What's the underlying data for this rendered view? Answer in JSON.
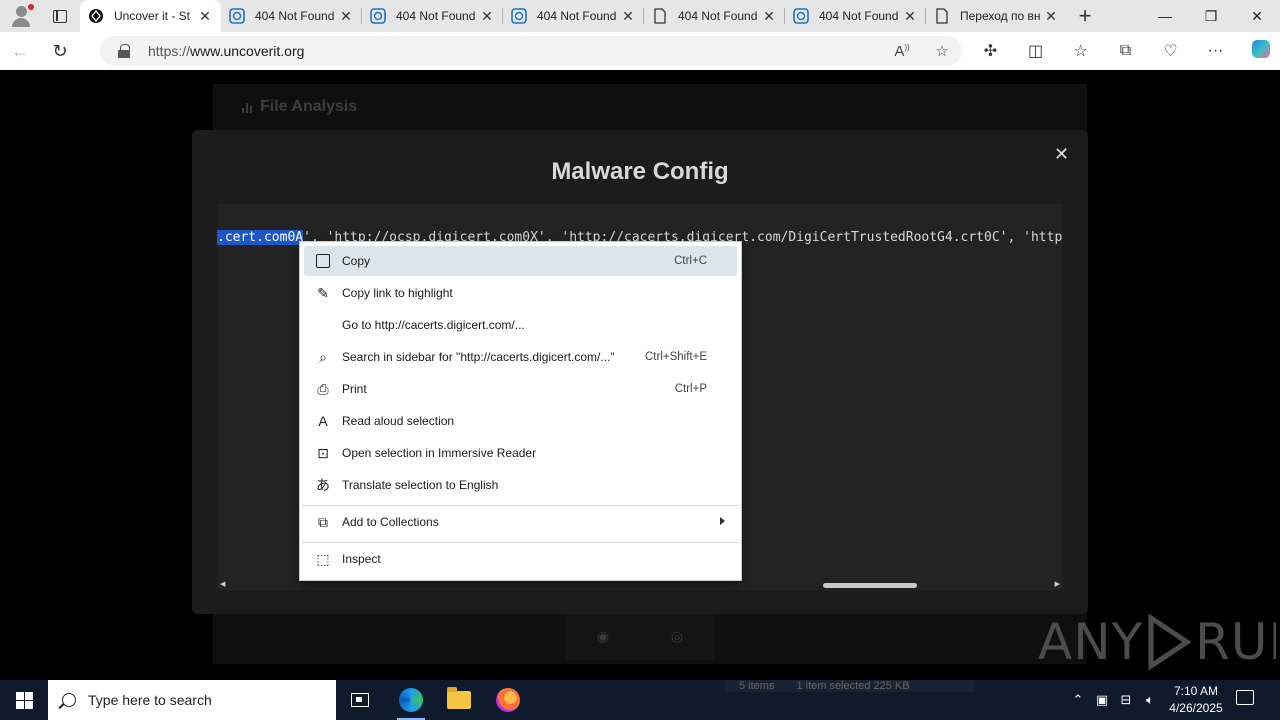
{
  "browser": {
    "tabs": [
      {
        "title": "Uncover it - St",
        "active": true,
        "favicon": "uncoverit-logo-icon"
      },
      {
        "title": "404 Not Found",
        "active": false,
        "favicon": "edge-page-icon"
      },
      {
        "title": "404 Not Found",
        "active": false,
        "favicon": "edge-page-icon"
      },
      {
        "title": "404 Not Found",
        "active": false,
        "favicon": "edge-page-icon"
      },
      {
        "title": "404 Not Found",
        "active": false,
        "favicon": "document-icon"
      },
      {
        "title": "404 Not Found",
        "active": false,
        "favicon": "edge-page-icon"
      },
      {
        "title": "Переход по вн",
        "active": false,
        "favicon": "document-icon"
      }
    ],
    "url_prefix": "https://",
    "url_host": "www.uncoverit.org"
  },
  "page": {
    "bg_title": "File Analysis",
    "modal": {
      "title": "Malware Config",
      "selected_text": ".cert.com0A",
      "code_rest": "', 'http://ocsp.digicert.com0X', 'http://cacerts.digicert.com/DigiCertTrustedRootG4.crt0C', 'http"
    },
    "watermark": "ANY RUN"
  },
  "context_menu": {
    "items": [
      {
        "label": "Copy",
        "shortcut": "Ctrl+C",
        "icon": "copy-icon"
      },
      {
        "label": "Copy link to highlight",
        "shortcut": "",
        "icon": "link-highlight-icon"
      },
      {
        "label": "Go to http://cacerts.digicert.com/...",
        "shortcut": "",
        "icon": ""
      },
      {
        "label": "Search in sidebar for \"http://cacerts.digicert.com/...\"",
        "shortcut": "Ctrl+Shift+E",
        "icon": "sidebar-search-icon"
      },
      {
        "label": "Print",
        "shortcut": "Ctrl+P",
        "icon": "print-icon"
      },
      {
        "label": "Read aloud selection",
        "shortcut": "",
        "icon": "read-aloud-icon"
      },
      {
        "label": "Open selection in Immersive Reader",
        "shortcut": "",
        "icon": "immersive-reader-icon"
      },
      {
        "label": "Translate selection to English",
        "shortcut": "",
        "icon": "translate-icon"
      },
      {
        "label": "Add to Collections",
        "shortcut": "",
        "icon": "collections-icon"
      },
      {
        "label": "Inspect",
        "shortcut": "",
        "icon": "inspect-icon"
      }
    ]
  },
  "taskbar": {
    "search_placeholder": "Type here to search",
    "explorer_items": "5 items",
    "explorer_selected": "1 item selected  225 KB",
    "time": "7:10 AM",
    "date": "4/26/2025"
  },
  "colors": {
    "selection": "#1d56c9",
    "menu_highlight": "#dce4ec",
    "taskbar": "#0f1a2c"
  }
}
